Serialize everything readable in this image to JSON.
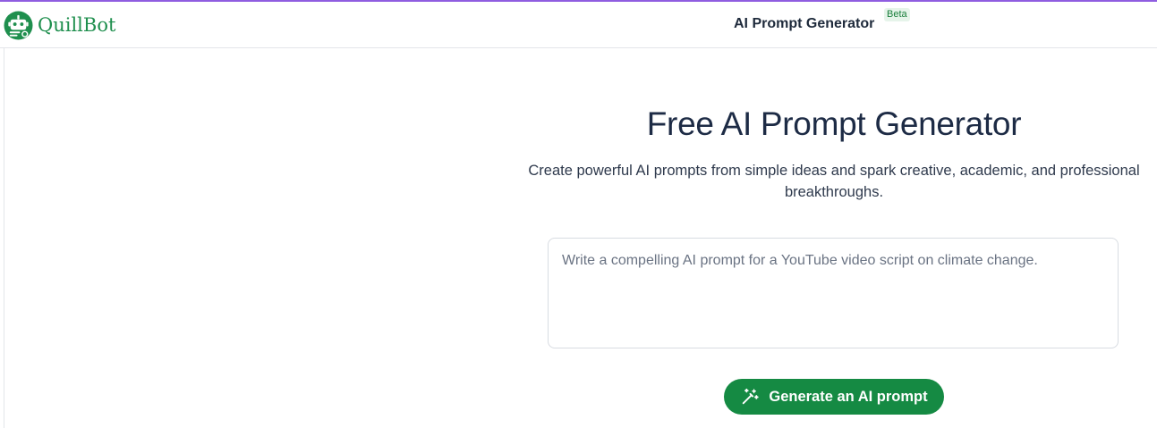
{
  "header": {
    "logo_text": "QuillBot",
    "app_title": "AI Prompt Generator",
    "badge": "Beta"
  },
  "main": {
    "title": "Free AI Prompt Generator",
    "subtitle": "Create powerful AI prompts from simple ideas and spark creative, academic, and professional breakthroughs.",
    "prompt_input": {
      "value": "",
      "placeholder": "Write a compelling AI prompt for a YouTube video script on climate change."
    },
    "generate_button": {
      "label": "Generate an AI prompt",
      "icon": "magic-wand-icon"
    }
  },
  "colors": {
    "brand_green": "#158a43",
    "accent_purple": "#8f5de0",
    "title_navy": "#1d2b45"
  }
}
